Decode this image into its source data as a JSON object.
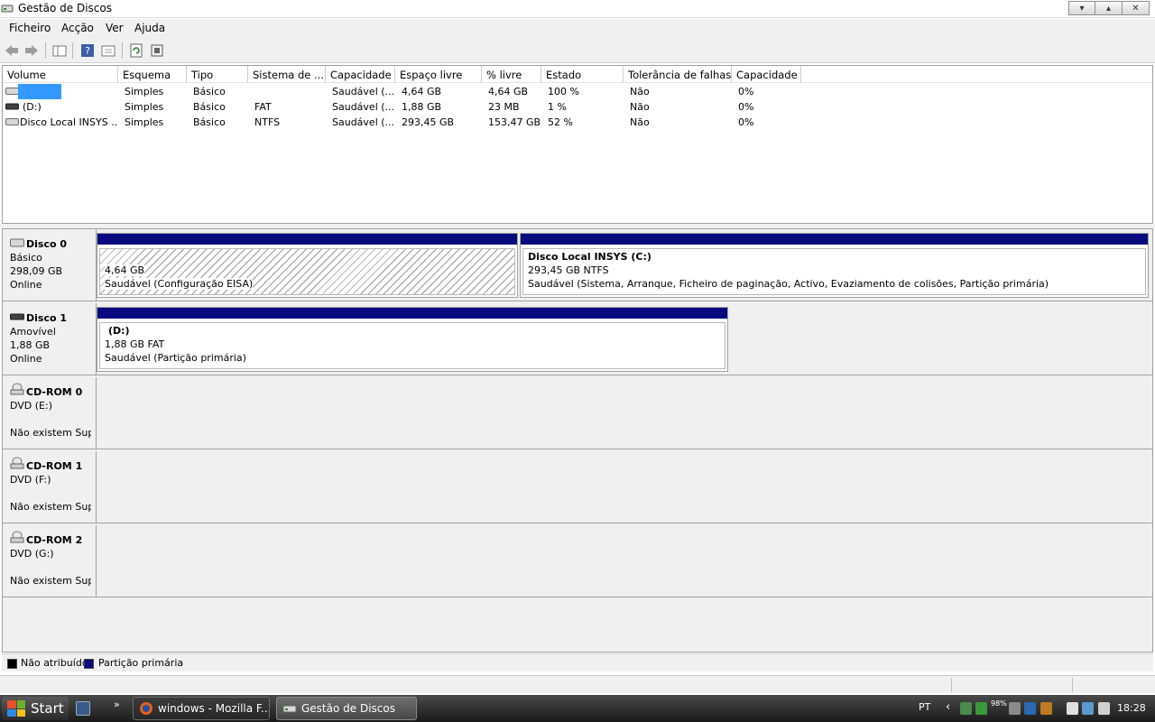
{
  "window": {
    "title": "Gestão de Discos",
    "controls": [
      "minimize",
      "maximize",
      "close"
    ]
  },
  "menu": [
    "Ficheiro",
    "Acção",
    "Ver",
    "Ajuda"
  ],
  "toolbar": [
    "back-icon",
    "forward-icon",
    "console-tree-icon",
    "help-icon",
    "properties-icon",
    "refresh-icon",
    "rescan-icon"
  ],
  "volume_list": {
    "columns": [
      "Volume",
      "Esquema",
      "Tipo",
      "Sistema de ...",
      "Capacidade",
      "Espaço livre",
      "% livre",
      "Estado",
      "Tolerância de falhas",
      "Capacidade"
    ],
    "rows": [
      {
        "volume": "",
        "selected": true,
        "icon": "hdd-icon",
        "esquema": "Simples",
        "tipo": "Básico",
        "sistema": "",
        "capacidade": "Saudável (...",
        "espaco": "4,64 GB",
        "pct": "4,64 GB",
        "estado": "100 %",
        "tolerancia": "Não",
        "capacidade2": "0%"
      },
      {
        "volume": "(D:)",
        "selected": false,
        "icon": "removable-drive-icon",
        "esquema": "Simples",
        "tipo": "Básico",
        "sistema": "FAT",
        "capacidade": "Saudável (...",
        "espaco": "1,88 GB",
        "pct": "23 MB",
        "estado": "1 %",
        "tolerancia": "Não",
        "capacidade2": "0%"
      },
      {
        "volume": "Disco Local INSYS ...",
        "selected": false,
        "icon": "hdd-icon",
        "esquema": "Simples",
        "tipo": "Básico",
        "sistema": "NTFS",
        "capacidade": "Saudável (...",
        "espaco": "293,45 GB",
        "pct": "153,47 GB",
        "estado": "52 %",
        "tolerancia": "Não",
        "capacidade2": "0%"
      }
    ]
  },
  "disks": [
    {
      "name": "Disco 0",
      "icon": "hdd-icon",
      "lines": [
        "Básico",
        "298,09 GB",
        "Online"
      ],
      "partitions": [
        {
          "title": "",
          "size": "4,64 GB",
          "status": "Saudável (Configuração EISA)",
          "hatched": true
        },
        {
          "title": "Disco Local INSYS  (C:)",
          "size": "293,45 GB NTFS",
          "status": "Saudável (Sistema, Arranque, Ficheiro de paginação, Activo, Evaziamento de colisões, Partição primária)",
          "hatched": false
        }
      ]
    },
    {
      "name": "Disco 1",
      "icon": "removable-drive-icon",
      "lines": [
        "Amovível",
        "1,88 GB",
        "Online"
      ],
      "partitions": [
        {
          "title": "(D:)",
          "size": "1,88 GB FAT",
          "status": "Saudável (Partição primária)",
          "hatched": false
        }
      ]
    },
    {
      "name": "CD-ROM 0",
      "icon": "cdrom-icon",
      "lines": [
        "DVD (E:)",
        "",
        "Não existem Sup"
      ],
      "partitions": []
    },
    {
      "name": "CD-ROM 1",
      "icon": "cdrom-icon",
      "lines": [
        "DVD (F:)",
        "",
        "Não existem Sup"
      ],
      "partitions": []
    },
    {
      "name": "CD-ROM 2",
      "icon": "cdrom-icon",
      "lines": [
        "DVD (G:)",
        "",
        "Não existem Sup"
      ],
      "partitions": []
    }
  ],
  "legend": [
    {
      "label": "Não atribuído",
      "color": "#000000"
    },
    {
      "label": "Partição primária",
      "color": "#0a0a80"
    }
  ],
  "taskbar": {
    "start": "Start",
    "chevron": "»",
    "tasks": [
      {
        "label": "windows - Mozilla F...",
        "icon": "firefox-icon",
        "active": false
      },
      {
        "label": "Gestão de Discos",
        "icon": "disk-management-icon",
        "active": true
      }
    ],
    "language": "PT",
    "tray_arrow": "‹",
    "battery": "98%",
    "clock": "18:28"
  },
  "colors": {
    "partition_bar": "#0a0a80",
    "selection": "#3399ff",
    "taskbar": "#2a2a2a"
  }
}
